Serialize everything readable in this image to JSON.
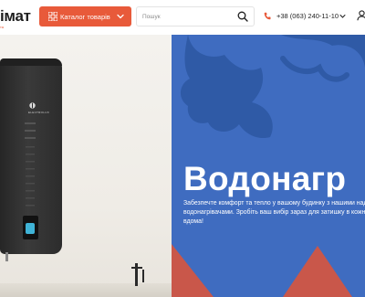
{
  "header": {
    "logo_text": "імат",
    "logo_sub": "та",
    "catalog_label": "Каталог товарів",
    "search_placeholder": "Пошук",
    "phone": "+38 (063) 240-11-10"
  },
  "hero": {
    "title": "Водонагр",
    "text_line1": "Забезпечте комфорт та тепло у вашому будинку з нашими над",
    "text_line2": "водонагрівачами. Зробіть ваш вибір зараз для затишку в кожн",
    "text_line3": "вдома!",
    "heater_brand": "ELECTROLUX"
  },
  "colors": {
    "accent": "#e85a3a",
    "hero_blue": "#3f6cc0",
    "hero_deco_blue": "#2f5aa6",
    "hero_deco_red": "#c9574a"
  }
}
